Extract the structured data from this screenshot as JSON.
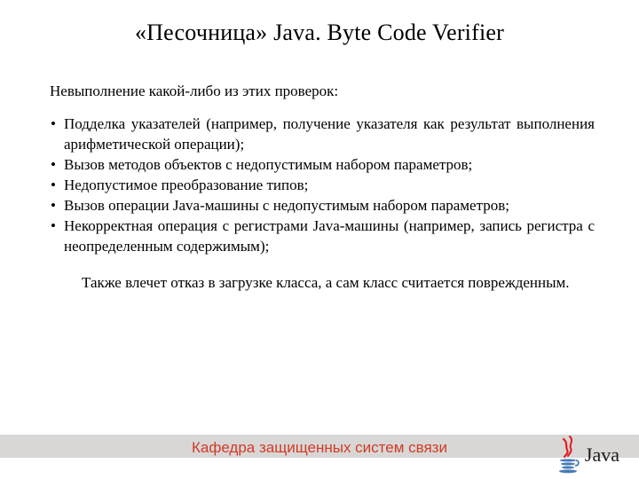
{
  "title": "«Песочница» Java. Byte Code Verifier",
  "intro": "Невыполнение какой-либо из этих проверок:",
  "bullets": [
    " Подделка указателей (например, получение указателя как результат выполнения арифметической операции);",
    "Вызов методов объектов с недопустимым набором параметров;",
    "Недопустимое преобразование типов;",
    "Вызов операции Java-машины с недопустимым набором параметров;",
    " Некорректная операция с регистрами Java-машины (например, запись регистра с неопределенным содержимым);"
  ],
  "outro": "Также влечет отказ в загрузке класса, а сам класс считается поврежденным.",
  "footer": "Кафедра защищенных систем связи",
  "logo_text": "Java"
}
